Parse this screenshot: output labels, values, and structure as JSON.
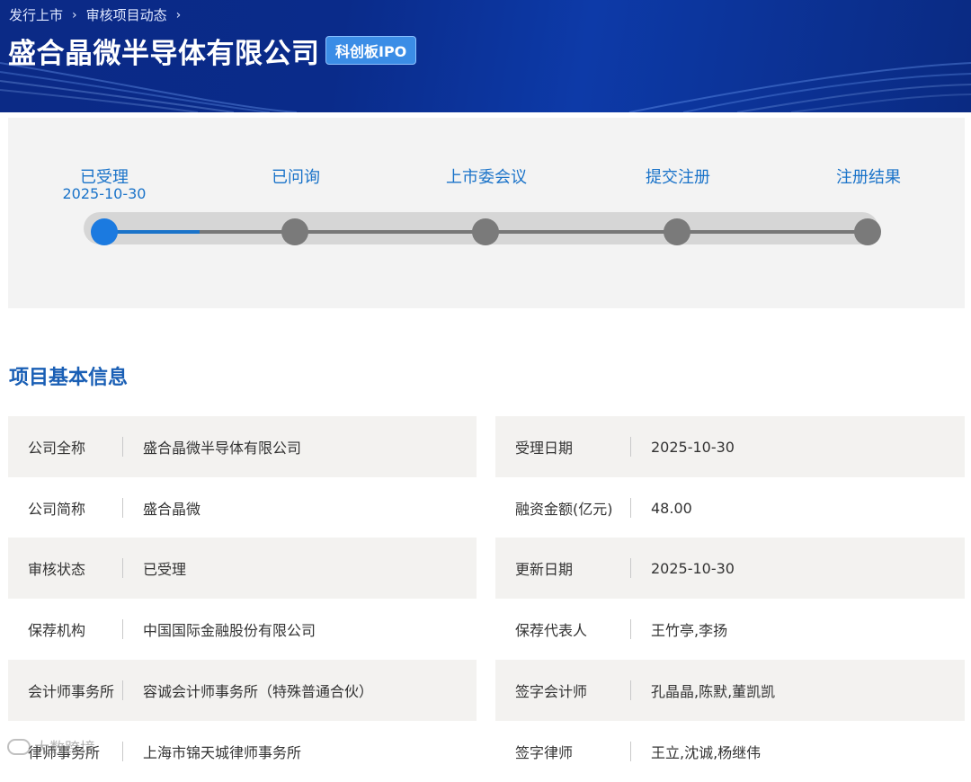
{
  "breadcrumb": {
    "items": [
      "发行上市",
      "审核项目动态"
    ]
  },
  "header": {
    "company_name": "盛合晶微半导体有限公司",
    "board_badge": "科创板IPO"
  },
  "progress": {
    "current_step_index": 0,
    "steps": [
      {
        "label": "已受理",
        "date": "2025-10-30"
      },
      {
        "label": "已问询",
        "date": ""
      },
      {
        "label": "上市委会议",
        "date": ""
      },
      {
        "label": "提交注册",
        "date": ""
      },
      {
        "label": "注册结果",
        "date": ""
      }
    ]
  },
  "section": {
    "title": "项目基本信息"
  },
  "info": {
    "left": [
      {
        "label": "公司全称",
        "value": "盛合晶微半导体有限公司"
      },
      {
        "label": "公司简称",
        "value": "盛合晶微"
      },
      {
        "label": "审核状态",
        "value": "已受理"
      },
      {
        "label": "保荐机构",
        "value": "中国国际金融股份有限公司"
      },
      {
        "label": "会计师事务所",
        "value": "容诚会计师事务所（特殊普通合伙）"
      },
      {
        "label": "律师事务所",
        "value": "上海市锦天城律师事务所"
      }
    ],
    "right": [
      {
        "label": "受理日期",
        "value": "2025-10-30"
      },
      {
        "label": "融资金额(亿元)",
        "value": "48.00"
      },
      {
        "label": "更新日期",
        "value": "2025-10-30"
      },
      {
        "label": "保荐代表人",
        "value": "王竹亭,李扬"
      },
      {
        "label": "签字会计师",
        "value": "孔晶晶,陈默,董凯凯"
      },
      {
        "label": "签字律师",
        "value": "王立,沈诚,杨继伟"
      }
    ]
  },
  "watermark": {
    "text": "大数跨境"
  },
  "colors": {
    "accent": "#1a73c9",
    "banner": "#0b2a86",
    "badge": "#3b8de6"
  }
}
